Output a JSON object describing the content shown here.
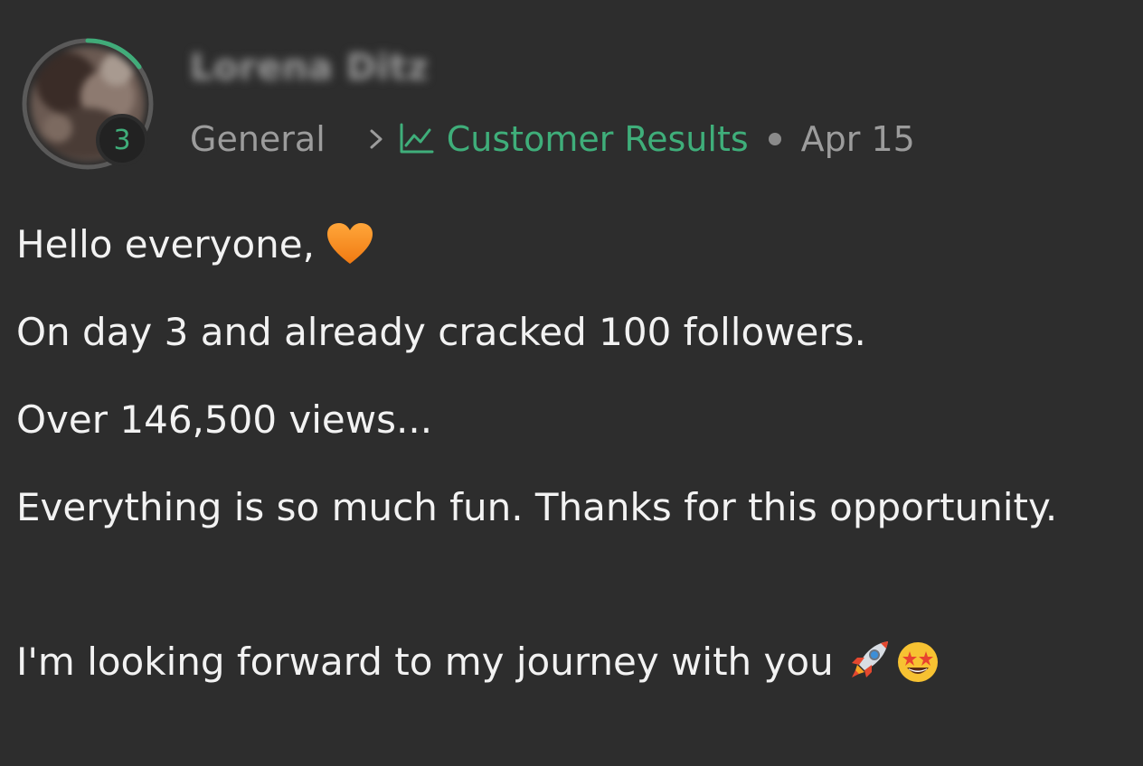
{
  "author": {
    "name": "Lorena Ditz",
    "level": "3"
  },
  "meta": {
    "category": "General",
    "channel": "Customer Results",
    "date": "Apr 15"
  },
  "icons": {
    "chevron": "chevron-right-icon",
    "channel": "trend-chart-icon",
    "heart": "orange-heart-emoji",
    "rocket": "rocket-emoji",
    "star_eyes": "star-struck-emoji"
  },
  "colors": {
    "background": "#2d2d2d",
    "accent": "#3fae7a",
    "muted": "#9c9c9c",
    "text": "#f2f2f2"
  },
  "body": {
    "line1": "Hello everyone,",
    "line2": "On day 3 and already cracked 100 followers.",
    "line3": "Over 146,500 views...",
    "line4": "Everything is so much fun. Thanks for this opportunity.",
    "line5": "I'm looking forward to my journey with you"
  }
}
